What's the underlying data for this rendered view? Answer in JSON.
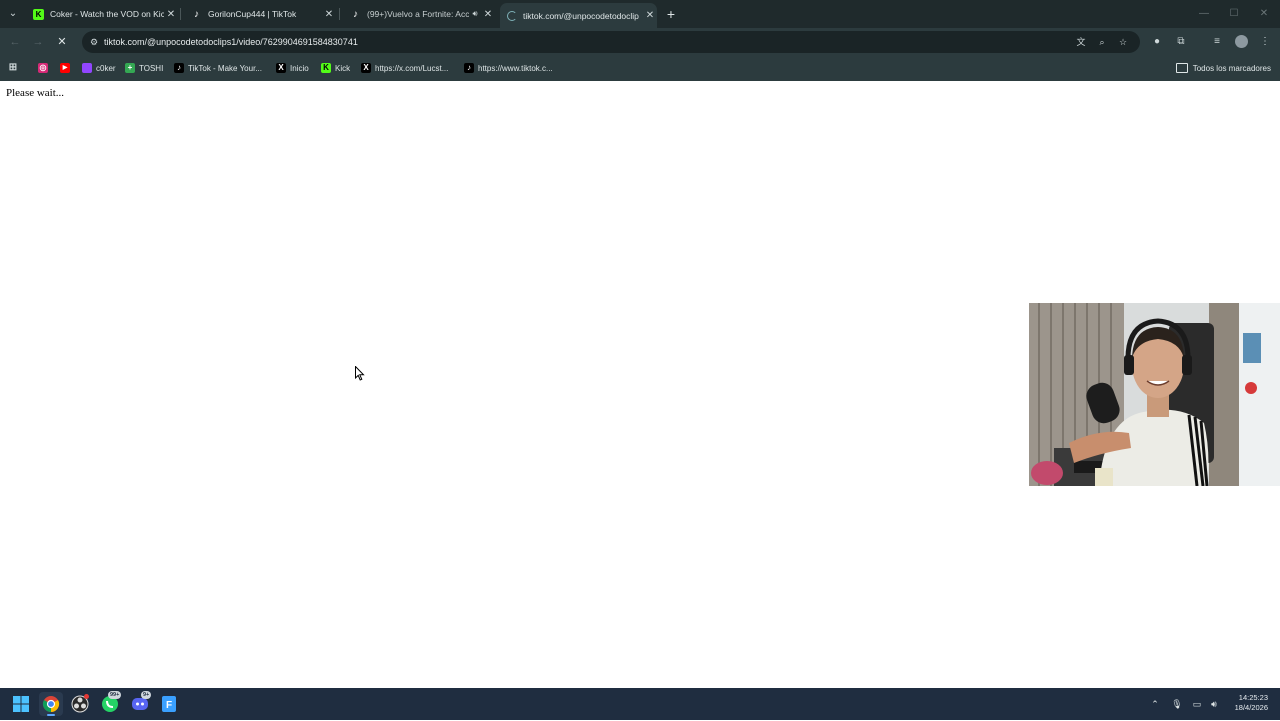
{
  "browser": {
    "tabs": [
      {
        "title": "Coker - Watch the VOD on Kick",
        "favicon": "kick-icon",
        "color": "#53fc18",
        "active": false,
        "audio": false
      },
      {
        "title": "GorilonCup444 | TikTok",
        "favicon": "tiktok-icon",
        "color": "#ffffff",
        "active": false,
        "audio": false
      },
      {
        "title": "(99+)Vuelvo a Fortnite: Acc",
        "favicon": "tiktok-icon",
        "color": "#ffffff",
        "active": false,
        "audio": true
      },
      {
        "title": "tiktok.com/@unpocodetodoclip",
        "favicon": "loading-icon",
        "color": "#7fb2b8",
        "active": true,
        "audio": false
      }
    ],
    "new_tab_label": "+",
    "url": "tiktok.com/@unpocodetodoclips1/video/7629904691584830741",
    "bookmarks": [
      {
        "label": "",
        "icon": "instagram-icon",
        "color": "#d62976"
      },
      {
        "label": "",
        "icon": "youtube-icon",
        "color": "#ff0000"
      },
      {
        "label": "c0ker",
        "icon": "twitch-icon",
        "color": "#9146ff"
      },
      {
        "label": "TOSHI",
        "icon": "plus-icon",
        "color": "#34a853"
      },
      {
        "label": "TikTok - Make Your...",
        "icon": "tiktok-icon",
        "color": "#000000"
      },
      {
        "label": "Inicio",
        "icon": "x-icon",
        "color": "#000000"
      },
      {
        "label": "Kick",
        "icon": "kick-icon",
        "color": "#53fc18"
      },
      {
        "label": "https://x.com/Lucst...",
        "icon": "x-icon",
        "color": "#000000"
      },
      {
        "label": "https://www.tiktok.c...",
        "icon": "tiktok-icon",
        "color": "#000000"
      }
    ],
    "all_bookmarks_label": "Todos los marcadores"
  },
  "page": {
    "message": "Please wait..."
  },
  "taskbar": {
    "apps": [
      {
        "name": "start-button",
        "color": "#2b8cff"
      },
      {
        "name": "chrome-app",
        "color": "#fbbc04"
      },
      {
        "name": "obs-app",
        "color": "#2a2a2a"
      },
      {
        "name": "whatsapp-app",
        "color": "#25d366",
        "badge": "99+"
      },
      {
        "name": "discord-app",
        "color": "#5865f2",
        "badge": "9+"
      },
      {
        "name": "file-app",
        "color": "#3aa0ff"
      }
    ],
    "time": "14:25:23",
    "date": "18/4/2026"
  }
}
